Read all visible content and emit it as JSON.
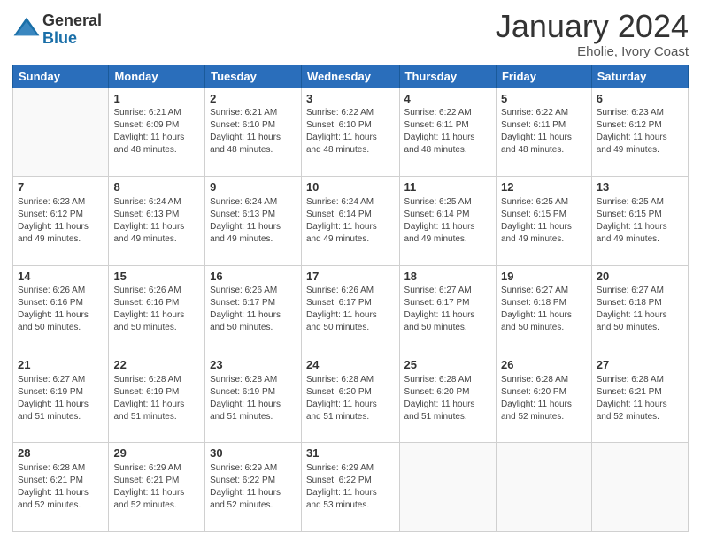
{
  "header": {
    "logo": {
      "general": "General",
      "blue": "Blue"
    },
    "title": "January 2024",
    "subtitle": "Eholie, Ivory Coast"
  },
  "columns": [
    "Sunday",
    "Monday",
    "Tuesday",
    "Wednesday",
    "Thursday",
    "Friday",
    "Saturday"
  ],
  "weeks": [
    [
      {
        "day": "",
        "info": ""
      },
      {
        "day": "1",
        "info": "Sunrise: 6:21 AM\nSunset: 6:09 PM\nDaylight: 11 hours\nand 48 minutes."
      },
      {
        "day": "2",
        "info": "Sunrise: 6:21 AM\nSunset: 6:10 PM\nDaylight: 11 hours\nand 48 minutes."
      },
      {
        "day": "3",
        "info": "Sunrise: 6:22 AM\nSunset: 6:10 PM\nDaylight: 11 hours\nand 48 minutes."
      },
      {
        "day": "4",
        "info": "Sunrise: 6:22 AM\nSunset: 6:11 PM\nDaylight: 11 hours\nand 48 minutes."
      },
      {
        "day": "5",
        "info": "Sunrise: 6:22 AM\nSunset: 6:11 PM\nDaylight: 11 hours\nand 48 minutes."
      },
      {
        "day": "6",
        "info": "Sunrise: 6:23 AM\nSunset: 6:12 PM\nDaylight: 11 hours\nand 49 minutes."
      }
    ],
    [
      {
        "day": "7",
        "info": "Sunrise: 6:23 AM\nSunset: 6:12 PM\nDaylight: 11 hours\nand 49 minutes."
      },
      {
        "day": "8",
        "info": "Sunrise: 6:24 AM\nSunset: 6:13 PM\nDaylight: 11 hours\nand 49 minutes."
      },
      {
        "day": "9",
        "info": "Sunrise: 6:24 AM\nSunset: 6:13 PM\nDaylight: 11 hours\nand 49 minutes."
      },
      {
        "day": "10",
        "info": "Sunrise: 6:24 AM\nSunset: 6:14 PM\nDaylight: 11 hours\nand 49 minutes."
      },
      {
        "day": "11",
        "info": "Sunrise: 6:25 AM\nSunset: 6:14 PM\nDaylight: 11 hours\nand 49 minutes."
      },
      {
        "day": "12",
        "info": "Sunrise: 6:25 AM\nSunset: 6:15 PM\nDaylight: 11 hours\nand 49 minutes."
      },
      {
        "day": "13",
        "info": "Sunrise: 6:25 AM\nSunset: 6:15 PM\nDaylight: 11 hours\nand 49 minutes."
      }
    ],
    [
      {
        "day": "14",
        "info": "Sunrise: 6:26 AM\nSunset: 6:16 PM\nDaylight: 11 hours\nand 50 minutes."
      },
      {
        "day": "15",
        "info": "Sunrise: 6:26 AM\nSunset: 6:16 PM\nDaylight: 11 hours\nand 50 minutes."
      },
      {
        "day": "16",
        "info": "Sunrise: 6:26 AM\nSunset: 6:17 PM\nDaylight: 11 hours\nand 50 minutes."
      },
      {
        "day": "17",
        "info": "Sunrise: 6:26 AM\nSunset: 6:17 PM\nDaylight: 11 hours\nand 50 minutes."
      },
      {
        "day": "18",
        "info": "Sunrise: 6:27 AM\nSunset: 6:17 PM\nDaylight: 11 hours\nand 50 minutes."
      },
      {
        "day": "19",
        "info": "Sunrise: 6:27 AM\nSunset: 6:18 PM\nDaylight: 11 hours\nand 50 minutes."
      },
      {
        "day": "20",
        "info": "Sunrise: 6:27 AM\nSunset: 6:18 PM\nDaylight: 11 hours\nand 50 minutes."
      }
    ],
    [
      {
        "day": "21",
        "info": "Sunrise: 6:27 AM\nSunset: 6:19 PM\nDaylight: 11 hours\nand 51 minutes."
      },
      {
        "day": "22",
        "info": "Sunrise: 6:28 AM\nSunset: 6:19 PM\nDaylight: 11 hours\nand 51 minutes."
      },
      {
        "day": "23",
        "info": "Sunrise: 6:28 AM\nSunset: 6:19 PM\nDaylight: 11 hours\nand 51 minutes."
      },
      {
        "day": "24",
        "info": "Sunrise: 6:28 AM\nSunset: 6:20 PM\nDaylight: 11 hours\nand 51 minutes."
      },
      {
        "day": "25",
        "info": "Sunrise: 6:28 AM\nSunset: 6:20 PM\nDaylight: 11 hours\nand 51 minutes."
      },
      {
        "day": "26",
        "info": "Sunrise: 6:28 AM\nSunset: 6:20 PM\nDaylight: 11 hours\nand 52 minutes."
      },
      {
        "day": "27",
        "info": "Sunrise: 6:28 AM\nSunset: 6:21 PM\nDaylight: 11 hours\nand 52 minutes."
      }
    ],
    [
      {
        "day": "28",
        "info": "Sunrise: 6:28 AM\nSunset: 6:21 PM\nDaylight: 11 hours\nand 52 minutes."
      },
      {
        "day": "29",
        "info": "Sunrise: 6:29 AM\nSunset: 6:21 PM\nDaylight: 11 hours\nand 52 minutes."
      },
      {
        "day": "30",
        "info": "Sunrise: 6:29 AM\nSunset: 6:22 PM\nDaylight: 11 hours\nand 52 minutes."
      },
      {
        "day": "31",
        "info": "Sunrise: 6:29 AM\nSunset: 6:22 PM\nDaylight: 11 hours\nand 53 minutes."
      },
      {
        "day": "",
        "info": ""
      },
      {
        "day": "",
        "info": ""
      },
      {
        "day": "",
        "info": ""
      }
    ]
  ]
}
